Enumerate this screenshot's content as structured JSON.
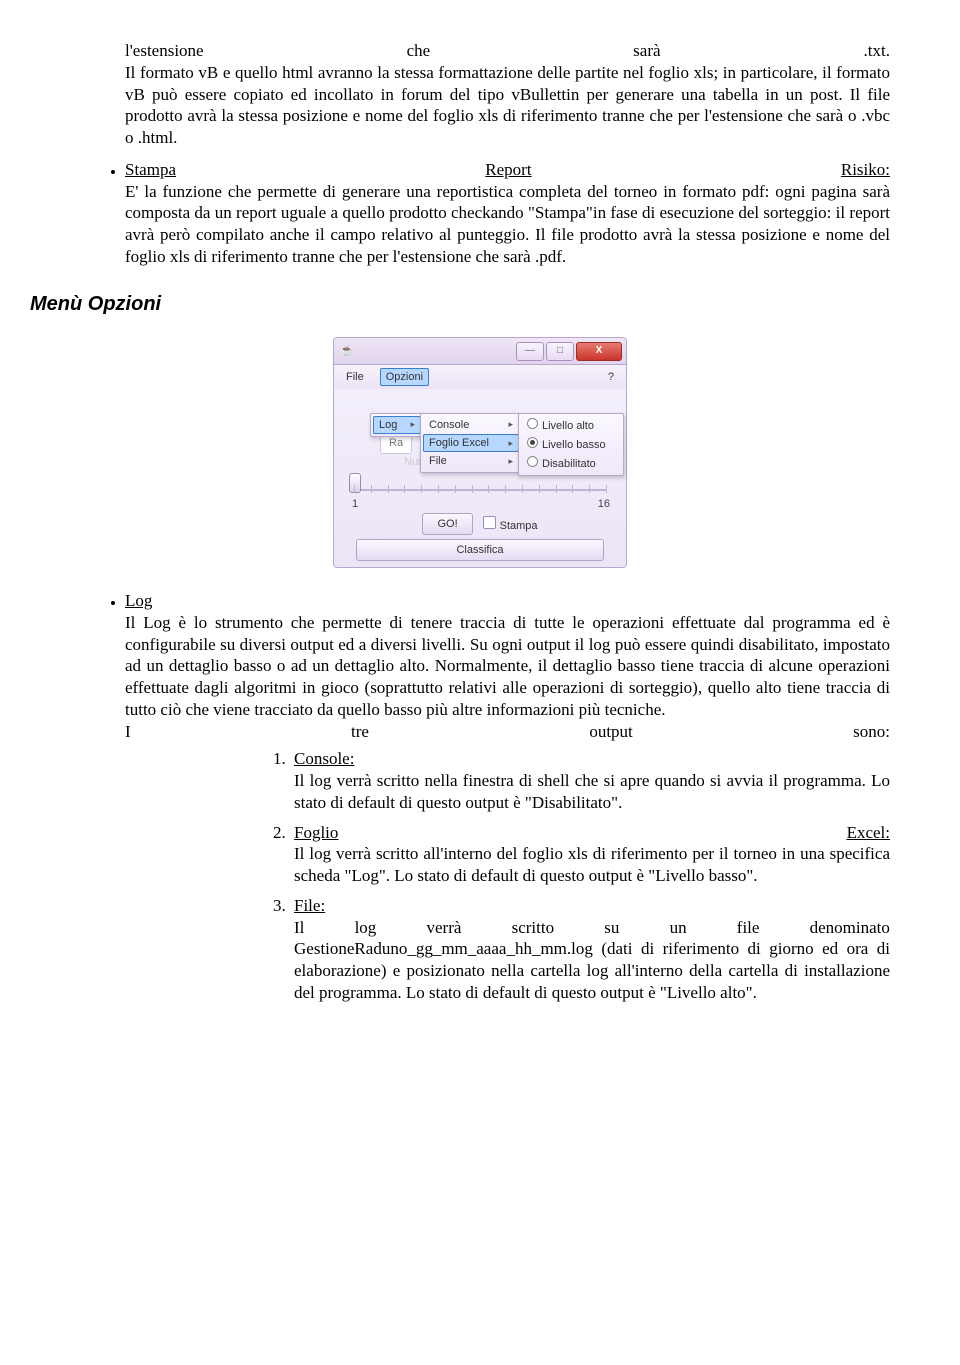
{
  "line0": {
    "a": "l'estensione",
    "b": "che",
    "c": "sarà",
    "d": ".txt."
  },
  "para1": "Il formato vB e quello html avranno la stessa formattazione delle partite nel foglio xls; in particolare, il formato vB può essere copiato ed incollato in forum del tipo vBullettin per generare una tabella in un post. Il file prodotto avrà la stessa posizione e nome del foglio xls di riferimento tranne che per l'estensione che sarà o .vbc o .html.",
  "bullet_stampa": {
    "title_a": "Stampa",
    "title_b": "Report",
    "title_c": "Risiko:",
    "body": "E' la funzione che permette di generare una reportistica completa del torneo in formato pdf: ogni pagina sarà composta da un report uguale a quello prodotto checkando \"Stampa\"in fase di esecuzione del sorteggio: il report avrà però compilato anche il campo relativo al punteggio. Il file prodotto avrà la stessa posizione e nome del foglio xls di riferimento tranne che per l'estensione che sarà .pdf."
  },
  "section_title": "Menù Opzioni",
  "screenshot": {
    "menubar": {
      "file": "File",
      "opzioni": "Opzioni",
      "help": "?"
    },
    "submenu_log": {
      "log": "Log"
    },
    "submenu_targets": {
      "console": "Console",
      "foglio": "Foglio Excel",
      "file": "File"
    },
    "submenu_levels": {
      "alto": "Livello alto",
      "basso": "Livello basso",
      "dis": "Disabilitato"
    },
    "bg_label": "Ra",
    "num_turni_hidden": "Numero Turni",
    "slider": {
      "min": "1",
      "max": "16"
    },
    "go": "GO!",
    "stampa": "Stampa",
    "classifica": "Classifica"
  },
  "bullet_log": {
    "title": "Log",
    "body_a": "Il Log è lo strumento che permette di tenere traccia di tutte le operazioni effettuate dal programma ed è configurabile su diversi output ed a diversi livelli. Su ogni output il log può essere quindi disabilitato, impostato ad un dettaglio basso o ad un dettaglio alto. Normalmente, il dettaglio basso tiene traccia di alcune operazioni effettuate dagli algoritmi in gioco (soprattutto relativi alle operazioni di sorteggio), quello alto tiene traccia di tutto ciò che viene tracciato da quello basso più altre informazioni più tecniche.",
    "line_tre": {
      "a": "I",
      "b": "tre",
      "c": "output",
      "d": "sono:"
    }
  },
  "numlist": {
    "i1": {
      "title": "Console:",
      "body": "Il log verrà scritto nella finestra di shell che si apre quando si avvia il programma. Lo stato di default di questo output è \"Disabilitato\"."
    },
    "i2": {
      "title_a": "Foglio",
      "title_b": "Excel:",
      "body": "Il log verrà scritto all'interno del foglio xls di riferimento per il torneo in una specifica scheda \"Log\". Lo stato di default di questo output è \"Livello basso\"."
    },
    "i3": {
      "title": "File:",
      "line": {
        "a": "Il",
        "b": "log",
        "c": "verrà",
        "d": "scritto",
        "e": "su",
        "f": "un",
        "g": "file",
        "h": "denominato"
      },
      "body": "GestioneRaduno_gg_mm_aaaa_hh_mm.log (dati di riferimento di giorno ed ora di elaborazione) e posizionato nella cartella log all'interno della cartella di installazione del programma. Lo stato di default di questo output è \"Livello alto\"."
    }
  }
}
